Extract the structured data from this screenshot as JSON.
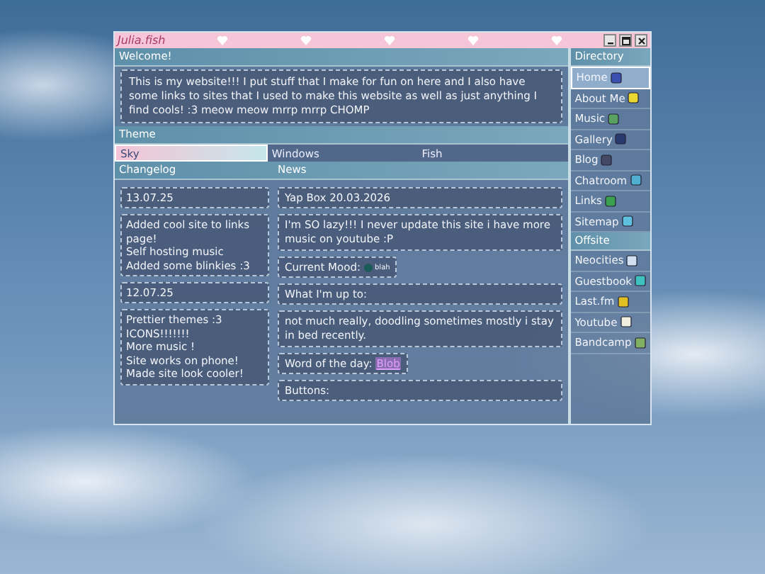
{
  "window": {
    "title": "Julia.fish"
  },
  "welcome": {
    "heading": "Welcome!",
    "text": "This is my website!!! I put stuff that I make for fun on here and I also have some links to sites that I used to make this website as well as just anything I find cools! :3 meow meow mrrp mrrp CHOMP"
  },
  "theme": {
    "heading": "Theme",
    "options": [
      {
        "label": "Sky",
        "selected": true
      },
      {
        "label": "Windows",
        "selected": false
      },
      {
        "label": "Fish",
        "selected": false
      }
    ]
  },
  "changelog": {
    "heading": "Changelog",
    "entries": [
      {
        "date": "13.07.25",
        "lines": [
          "Added cool site to links page!",
          "Self hosting music",
          "Added some blinkies :3"
        ]
      },
      {
        "date": "12.07.25",
        "lines": [
          "Prettier themes :3",
          "ICONS!!!!!!!",
          "More music !",
          "Site works on phone!",
          "Made site look cooler!"
        ]
      }
    ]
  },
  "news": {
    "heading": "News",
    "items": [
      {
        "kind": "title",
        "text": "Yap Box 20.03.2026"
      },
      {
        "kind": "body",
        "text": "I'm SO lazy!!! I never update this site i have more music on youtube :P"
      },
      {
        "kind": "mood",
        "label": "Current Mood:",
        "value": "blah"
      },
      {
        "kind": "title",
        "text": "What I'm up to:"
      },
      {
        "kind": "body",
        "text": "not much really, doodling sometimes mostly i stay in bed recently."
      },
      {
        "kind": "word",
        "label": "Word of the day:",
        "value": "Blob"
      },
      {
        "kind": "title",
        "text": "Buttons:"
      }
    ]
  },
  "directory": {
    "heading": "Directory",
    "items": [
      {
        "label": "Home",
        "selected": true
      },
      {
        "label": "About Me",
        "selected": false
      },
      {
        "label": "Music",
        "selected": false
      },
      {
        "label": "Gallery",
        "selected": false
      },
      {
        "label": "Blog",
        "selected": false
      },
      {
        "label": "Chatroom",
        "selected": false
      },
      {
        "label": "Links",
        "selected": false
      },
      {
        "label": "Sitemap",
        "selected": false
      }
    ]
  },
  "offsite": {
    "heading": "Offsite",
    "items": [
      {
        "label": "Neocities"
      },
      {
        "label": "Guestbook"
      },
      {
        "label": "Last.fm"
      },
      {
        "label": "Youtube"
      },
      {
        "label": "Bandcamp"
      }
    ]
  }
}
